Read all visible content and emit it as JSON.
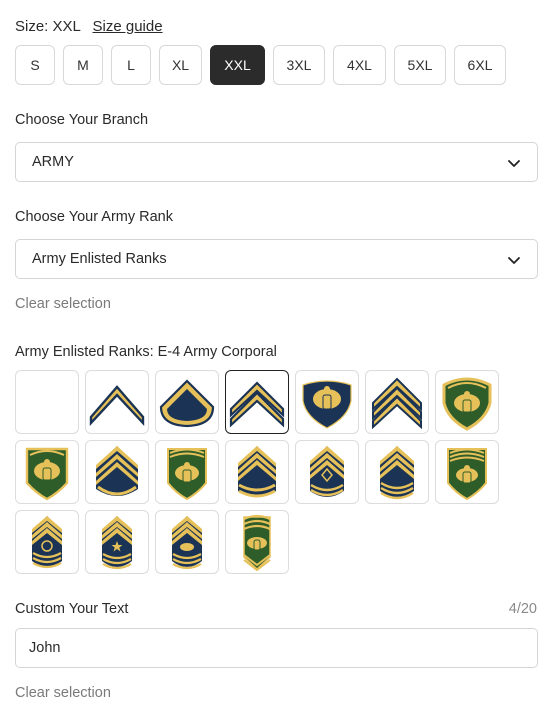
{
  "size": {
    "label": "Size:",
    "current": "XXL",
    "guide_label": "Size guide",
    "options": [
      "S",
      "M",
      "L",
      "XL",
      "XXL",
      "3XL",
      "4XL",
      "5XL",
      "6XL"
    ],
    "selected": "XXL"
  },
  "branch": {
    "label": "Choose Your Branch",
    "value": "ARMY"
  },
  "rank": {
    "label": "Choose Your Army Rank",
    "value": "Army Enlisted Ranks",
    "clear_label": "Clear selection"
  },
  "insignia": {
    "label": "Army Enlisted Ranks: E-4 Army Corporal",
    "tiles": [
      {
        "icon": "blank-tile"
      },
      {
        "icon": "pvt-chevron-icon"
      },
      {
        "icon": "pfc-chevron-icon"
      },
      {
        "icon": "cpl-chevron-icon",
        "selected": true
      },
      {
        "icon": "spc-eagle-icon"
      },
      {
        "icon": "sgt-chevron-icon"
      },
      {
        "icon": "spc5-eagle-icon"
      },
      {
        "icon": "spc6-eagle-icon"
      },
      {
        "icon": "ssg-chevron-icon"
      },
      {
        "icon": "spc7-eagle-icon"
      },
      {
        "icon": "sfc-chevron-icon"
      },
      {
        "icon": "msg-diamond-icon"
      },
      {
        "icon": "1sg-chevron-icon"
      },
      {
        "icon": "spc8-eagle-icon"
      },
      {
        "icon": "sgm-star-icon"
      },
      {
        "icon": "csm-star-icon"
      },
      {
        "icon": "sma-eagle-icon"
      },
      {
        "icon": "sma2-eagle-icon"
      }
    ],
    "colors": {
      "gold": "#e6c15a",
      "navy": "#1b3354",
      "green": "#2e5d2a"
    }
  },
  "custom_text": {
    "label": "Custom Your Text",
    "counter": "4/20",
    "value": "John",
    "clear_label": "Clear selection"
  }
}
